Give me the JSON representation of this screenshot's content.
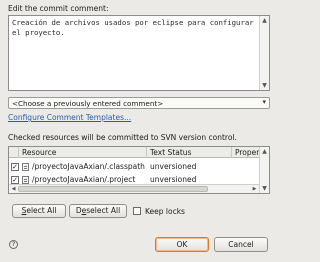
{
  "commit": {
    "label": "Edit the commit comment:",
    "text": "Creación de archivos usados por eclipse para configurar\nel proyecto."
  },
  "previous_comment": {
    "selected": "<Choose a previously entered comment>"
  },
  "configure_link": "Configure Comment Templates...",
  "resources_caption": "Checked resources will be committed to SVN version control.",
  "table": {
    "columns": [
      "Resource",
      "Text Status",
      "Property S"
    ],
    "rows": [
      {
        "checked": true,
        "resource": "/proyectoJavaAxian/.classpath",
        "text_status": "unversioned",
        "property_status": ""
      },
      {
        "checked": true,
        "resource": "/proyectoJavaAxian/.project",
        "text_status": "unversioned",
        "property_status": ""
      }
    ]
  },
  "buttons": {
    "select_all": "Select All",
    "deselect_all": "Deselect All",
    "keep_locks": "Keep locks",
    "ok": "OK",
    "cancel": "Cancel"
  },
  "keep_locks_checked": false,
  "icons": {
    "help": "help-icon",
    "file": "file-icon",
    "dropdown": "chevron-down-icon"
  },
  "colors": {
    "dialog_bg": "#eceae7",
    "link": "#2a5db0",
    "ok_border": "#e0762a"
  }
}
